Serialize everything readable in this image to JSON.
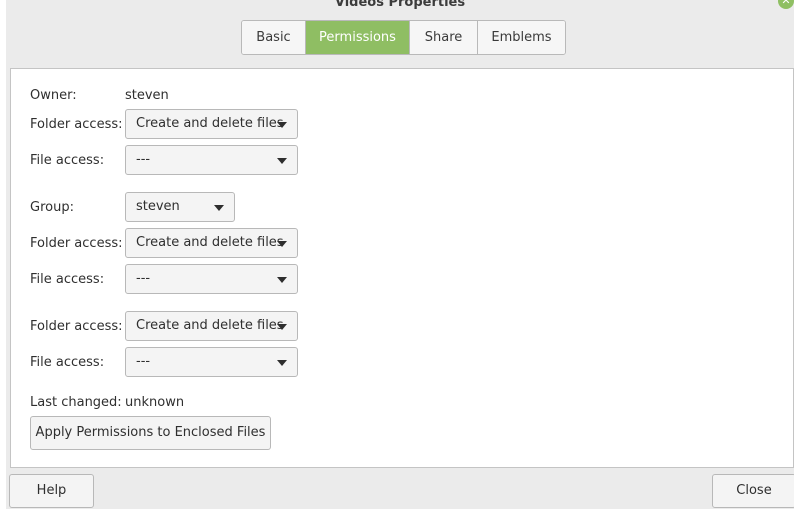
{
  "window": {
    "title": "Videos Properties",
    "close_icon": "close-icon"
  },
  "tabs": [
    {
      "label": "Basic",
      "active": false
    },
    {
      "label": "Permissions",
      "active": true
    },
    {
      "label": "Share",
      "active": false
    },
    {
      "label": "Emblems",
      "active": false
    }
  ],
  "owner": {
    "label": "Owner:",
    "value": "steven",
    "folder_access_label": "Folder access:",
    "folder_access": "Create and delete files",
    "file_access_label": "File access:",
    "file_access": "---"
  },
  "group": {
    "label": "Group:",
    "value": "steven",
    "folder_access_label": "Folder access:",
    "folder_access": "Create and delete files",
    "file_access_label": "File access:",
    "file_access": "---"
  },
  "others": {
    "folder_access_label": "Folder access:",
    "folder_access": "Create and delete files",
    "file_access_label": "File access:",
    "file_access": "---"
  },
  "last_changed": {
    "label": "Last changed:",
    "value": "unknown"
  },
  "apply_button": "Apply Permissions to Enclosed Files",
  "footer": {
    "help": "Help",
    "close": "Close"
  },
  "colors": {
    "accent": "#8fbe63",
    "panel": "#ffffff",
    "chrome": "#ebebeb"
  }
}
